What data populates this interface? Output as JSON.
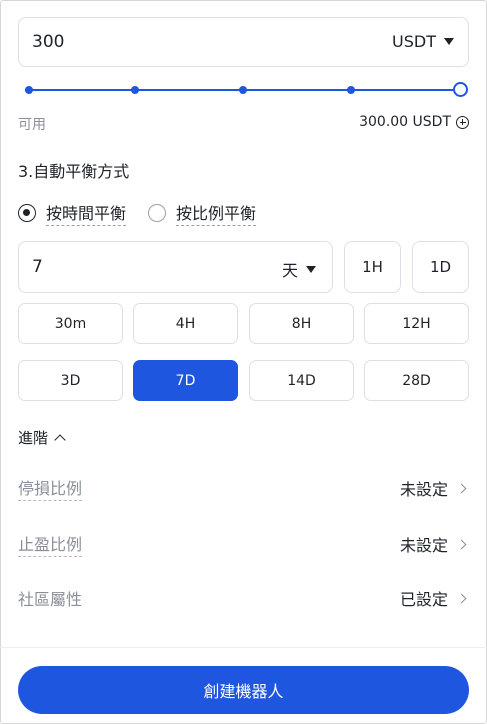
{
  "amount": {
    "value": "300",
    "currency": "USDT"
  },
  "slider": {
    "level_fraction": 1.0,
    "stops": 5
  },
  "available": {
    "label": "可用",
    "value": "300.00 USDT"
  },
  "section": {
    "title": "3.自動平衡方式"
  },
  "rebalance": {
    "option_time": "按時間平衡",
    "option_ratio": "按比例平衡",
    "selected": "option_time"
  },
  "interval": {
    "value": "7",
    "unit": "天",
    "quick": [
      "1H",
      "1D"
    ]
  },
  "presets": [
    "30m",
    "4H",
    "8H",
    "12H",
    "3D",
    "7D",
    "14D",
    "28D"
  ],
  "presets_selected": "7D",
  "advanced": {
    "label": "進階"
  },
  "settings": [
    {
      "label": "停損比例",
      "value": "未設定"
    },
    {
      "label": "止盈比例",
      "value": "未設定"
    },
    {
      "label": "社區屬性",
      "value": "已設定"
    }
  ],
  "create_button": "創建機器人",
  "colors": {
    "accent": "#1f56e0",
    "muted": "#8a8f99",
    "border": "#dcdfe5"
  },
  "icons": [
    "dropdown-caret-icon",
    "plus-circle-icon",
    "chevron-up-icon",
    "chevron-right-icon"
  ]
}
